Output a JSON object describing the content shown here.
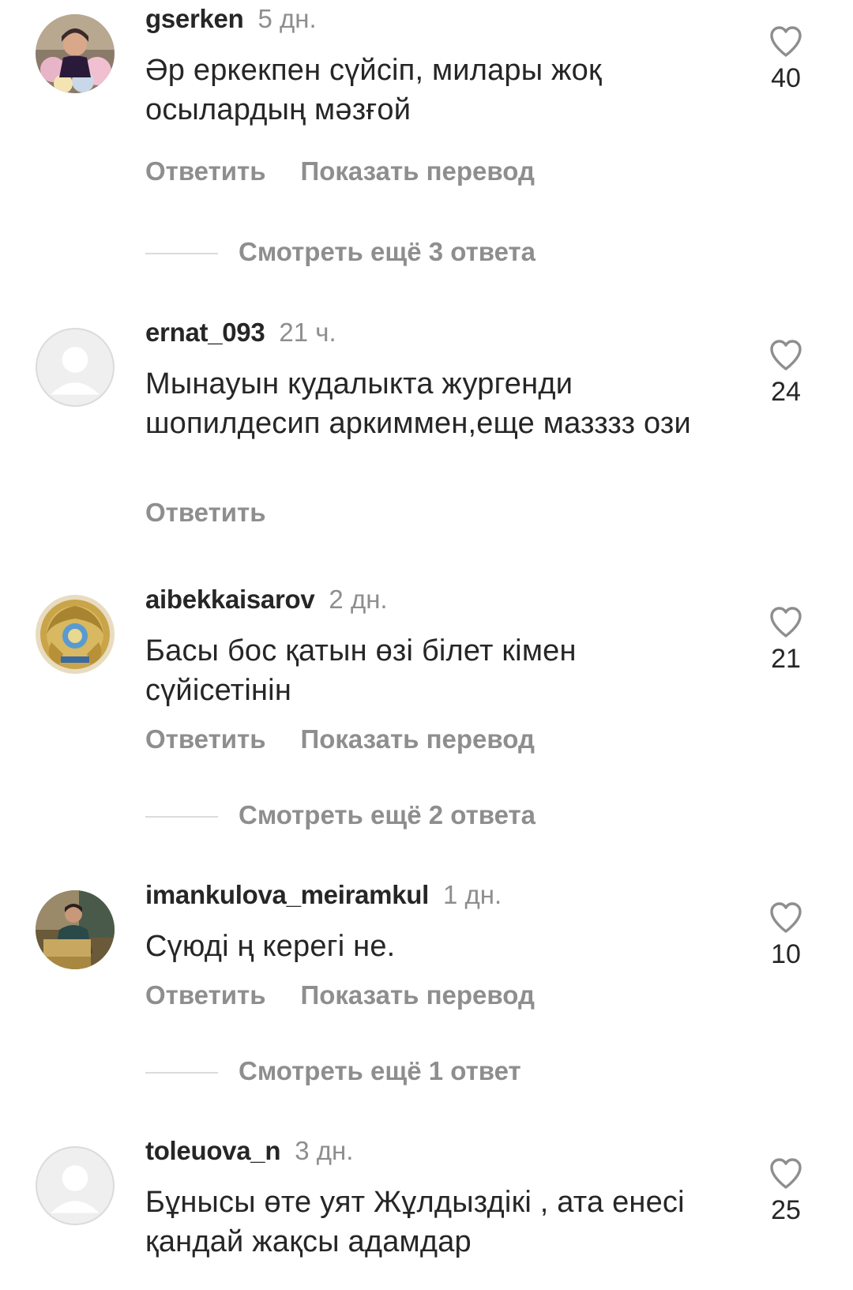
{
  "actions": {
    "reply_label": "Ответить",
    "translate_label": "Показать перевод"
  },
  "comments": [
    {
      "username": "gserken",
      "time": "5 дн.",
      "text": "Әр еркекпен сүйсіп, милары жоқ осылардың мәзғой",
      "likes": "40",
      "more_replies": "Смотреть ещё 3 ответа"
    },
    {
      "username": "ernat_093",
      "time": "21 ч.",
      "text": "Мынауын кудалыкта жургенди шопилдесип аркиммен,еще мазззз ози",
      "likes": "24"
    },
    {
      "username": "aibekkaisarov",
      "time": "2 дн.",
      "text": "Басы бос қатын өзі білет кімен сүйісетінін",
      "likes": "21",
      "more_replies": "Смотреть ещё 2 ответа"
    },
    {
      "username": "imankulova_meiramkul",
      "time": "1 дн.",
      "text": "Сүюді ң керегі не.",
      "likes": "10",
      "more_replies": "Смотреть ещё 1 ответ"
    },
    {
      "username": "toleuova_n",
      "time": "3 дн.",
      "text": "Бұнысы өте уят Жұлдыздікі , ата енесі қандай жақсы адамдар",
      "likes": "25"
    }
  ],
  "icons": {
    "like": "heart-outline-icon",
    "default_avatar": "default-avatar-icon"
  },
  "colors": {
    "primary_text": "#262626",
    "secondary_text": "#8e8e8e",
    "divider": "#dbdbdb"
  }
}
